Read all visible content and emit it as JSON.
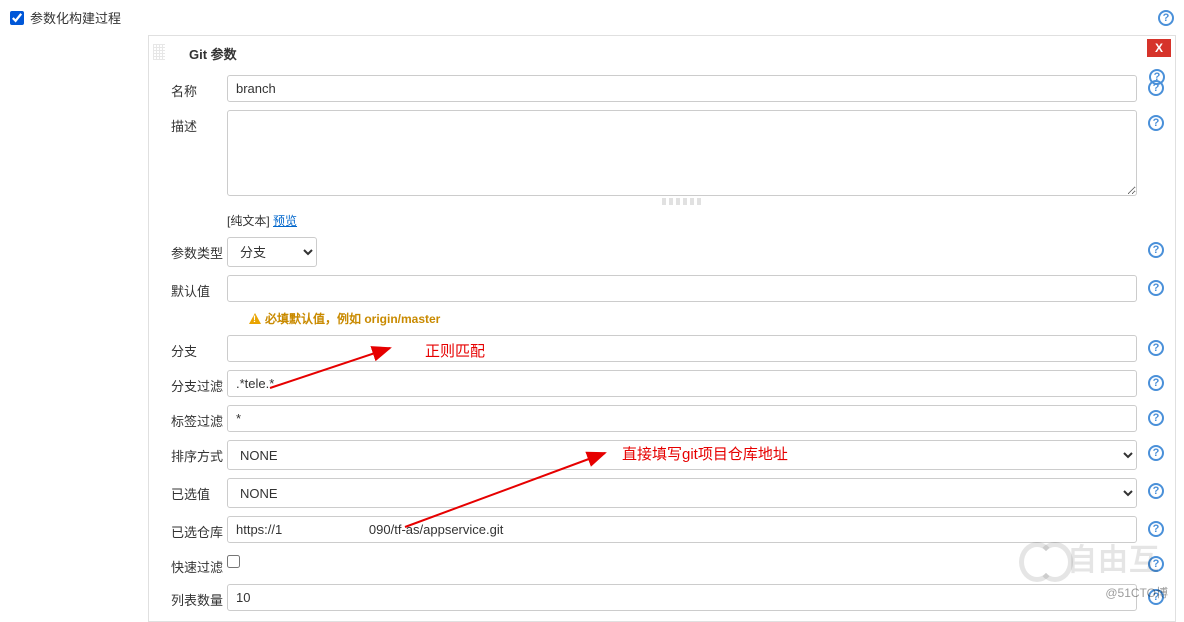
{
  "top": {
    "checkbox_label": "参数化构建过程",
    "checked": true
  },
  "section": {
    "title": "Git 参数",
    "close": "X"
  },
  "fields": {
    "name": {
      "label": "名称",
      "value": "branch"
    },
    "desc": {
      "label": "描述",
      "value": "",
      "plain_text": "[纯文本]",
      "preview": "预览"
    },
    "param_type": {
      "label": "参数类型",
      "options": [
        "分支"
      ],
      "selected": "分支"
    },
    "default": {
      "label": "默认值",
      "value": "",
      "warning": "必填默认值，例如 origin/master"
    },
    "branch": {
      "label": "分支",
      "value": ""
    },
    "branch_filter": {
      "label": "分支过滤",
      "value": ".*tele.*"
    },
    "tag_filter": {
      "label": "标签过滤",
      "value": "*"
    },
    "sort": {
      "label": "排序方式",
      "options": [
        "NONE"
      ],
      "selected": "NONE"
    },
    "selected_val": {
      "label": "已选值",
      "options": [
        "NONE"
      ],
      "selected": "NONE"
    },
    "selected_repo": {
      "label": "已选仓库",
      "value": "https://1                        090/tf-as/appservice.git"
    },
    "fast_filter": {
      "label": "快速过滤",
      "checked": false
    },
    "list_count": {
      "label": "列表数量",
      "value": "10"
    }
  },
  "annotations": {
    "regex": "正则匹配",
    "repo": "直接填写git项目仓库地址"
  },
  "watermark": {
    "text": "自由互",
    "attr": "@51CTO博"
  }
}
